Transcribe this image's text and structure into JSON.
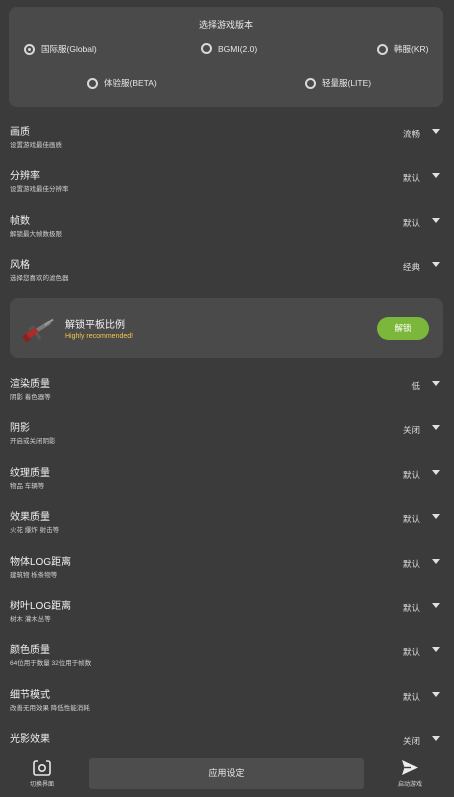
{
  "version": {
    "title": "选择游戏版本",
    "options": [
      {
        "label": "国际服(Global)",
        "selected": true
      },
      {
        "label": "BGMI(2.0)",
        "selected": false
      },
      {
        "label": "韩服(KR)",
        "selected": false
      },
      {
        "label": "体验服(BETA)",
        "selected": false
      },
      {
        "label": "轻量服(LITE)",
        "selected": false
      }
    ]
  },
  "settings_top": [
    {
      "label": "画质",
      "desc": "设置游戏最佳画质",
      "value": "流畅"
    },
    {
      "label": "分辨率",
      "desc": "设置游戏最佳分辨率",
      "value": "默认"
    },
    {
      "label": "帧数",
      "desc": "解锁最大帧数极限",
      "value": "默认"
    },
    {
      "label": "风格",
      "desc": "选择您喜欢的滤色器",
      "value": "经典"
    }
  ],
  "promo": {
    "title": "解锁平板比例",
    "subtitle": "Highly recommended!",
    "button_label": "解锁",
    "button_color": "#7bb73a",
    "icon": "rifle-icon"
  },
  "settings_bottom": [
    {
      "label": "渲染质量",
      "desc": "阴影 着色器等",
      "value": "低"
    },
    {
      "label": "阴影",
      "desc": "开启或关闭阴影",
      "value": "关闭"
    },
    {
      "label": "纹理质量",
      "desc": "物品 车辆等",
      "value": "默认"
    },
    {
      "label": "效果质量",
      "desc": "火花 爆炸 射击等",
      "value": "默认"
    },
    {
      "label": "物体LOG距离",
      "desc": "建筑物 栎条物等",
      "value": "默认"
    },
    {
      "label": "树叶LOG距离",
      "desc": "树木 灌木丛等",
      "value": "默认"
    },
    {
      "label": "颜色质量",
      "desc": "64位用于数量 32位用于帧数",
      "value": "默认"
    },
    {
      "label": "细节模式",
      "desc": "改善无用效果 降低性能消耗",
      "value": "默认"
    },
    {
      "label": "光影效果",
      "desc": "",
      "value": "关闭"
    }
  ],
  "bottom_bar": {
    "left_label": "切换界面",
    "apply_label": "应用设定",
    "right_label": "启动游戏"
  }
}
